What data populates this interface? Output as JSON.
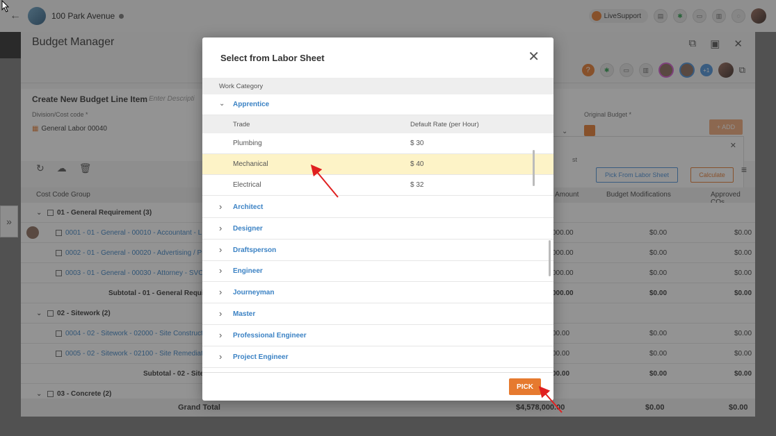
{
  "topbar": {
    "project_name": "100 Park Avenue",
    "livesupport": "LiveSupport"
  },
  "budget_manager": {
    "title": "Budget Manager",
    "create_title": "Create New Budget Line Item",
    "description_placeholder": "Enter Descripti",
    "division_label": "Division/Cost code *",
    "division_value": "General Labor 00040",
    "original_budget_label": "Original Budget *",
    "add_label": "+ ADD",
    "pick_from_labor_sheet": "Pick From Labor Sheet",
    "calculate": "Calculate",
    "popup_stub": "st",
    "grid_headers": [
      "Cost Code Group",
      "Amount",
      "Budget Modifications",
      "Approved COs"
    ],
    "rows": [
      {
        "text": "01 - General Requirement (3)",
        "kind": "group",
        "amount": "",
        "mods": "",
        "cos": ""
      },
      {
        "text": "0001 - 01 - General - 00010 - Accountant - L - La",
        "kind": "item",
        "amount": "000.00",
        "mods": "$0.00",
        "cos": "$0.00"
      },
      {
        "text": "0002 - 01 - General - 00020 - Advertising / Public",
        "kind": "item",
        "amount": "000.00",
        "mods": "$0.00",
        "cos": "$0.00"
      },
      {
        "text": "0003 - 01 - General - 00030 - Attorney - SVC - Pro",
        "kind": "item",
        "amount": "000.00",
        "mods": "$0.00",
        "cos": "$0.00"
      },
      {
        "text": "Subtotal - 01 - General Requirem",
        "kind": "subtotal",
        "amount": "000.00",
        "mods": "$0.00",
        "cos": "$0.00"
      },
      {
        "text": "02 - Sitework (2)",
        "kind": "group",
        "amount": "",
        "mods": "",
        "cos": ""
      },
      {
        "text": "0004 - 02 - Sitework - 02000 - Site Construction",
        "kind": "item",
        "amount": "00.00",
        "mods": "$0.00",
        "cos": "$0.00"
      },
      {
        "text": "0005 - 02 - Sitework - 02100 - Site Remediation",
        "kind": "item",
        "amount": "00.00",
        "mods": "$0.00",
        "cos": "$0.00"
      },
      {
        "text": "Subtotal - 02 - Sitew",
        "kind": "subtotal",
        "amount": "00.00",
        "mods": "$0.00",
        "cos": "$0.00"
      },
      {
        "text": "03 - Concrete (2)",
        "kind": "group",
        "amount": "",
        "mods": "",
        "cos": ""
      }
    ],
    "grand_total": {
      "label": "Grand Total",
      "amount": "$4,578,000.00",
      "mods": "$0.00",
      "cos": "$0.00"
    }
  },
  "modal": {
    "title": "Select from Labor Sheet",
    "work_category_header": "Work Category",
    "expanded_category": "Apprentice",
    "trade_header": "Trade",
    "rate_header": "Default Rate (per Hour)",
    "trades": [
      {
        "trade": "Plumbing",
        "rate": "$ 30",
        "selected": false
      },
      {
        "trade": "Mechanical",
        "rate": "$ 40",
        "selected": true
      },
      {
        "trade": "Electrical",
        "rate": "$ 32",
        "selected": false
      }
    ],
    "categories": [
      "Architect",
      "Designer",
      "Draftsperson",
      "Engineer",
      "Journeyman",
      "Master",
      "Professional Engineer",
      "Project Engineer"
    ],
    "pick_label": "PICK"
  },
  "colors": {
    "accent": "#e67a2f",
    "link": "#3b82c4",
    "selected_row": "#fdf3c7",
    "annotation_arrow": "#e02020"
  },
  "icons": [
    "back-arrow-icon",
    "close-icon",
    "chevron-down-icon",
    "chevron-right-icon",
    "refresh-icon",
    "cloud-upload-icon",
    "trash-icon",
    "external-link-icon",
    "expand-icon",
    "menu-icon"
  ]
}
